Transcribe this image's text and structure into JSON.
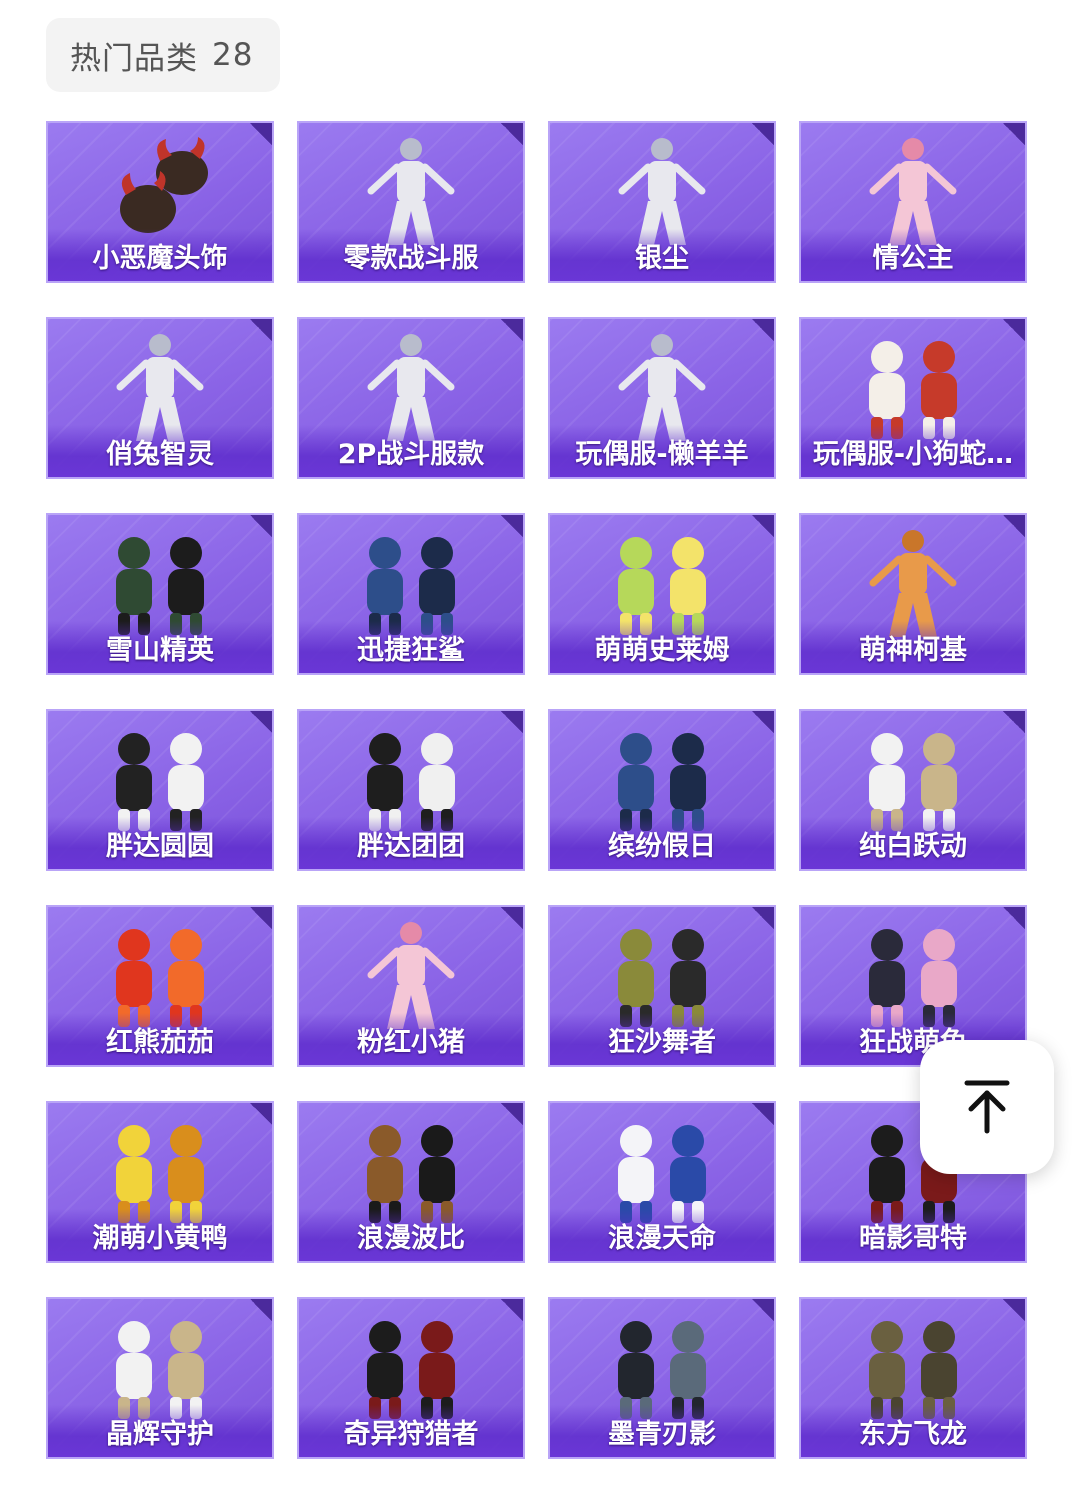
{
  "header": {
    "title": "热门品类",
    "count": "28"
  },
  "back_to_top_icon": "arrow-up-to-top-icon",
  "colors": {
    "card_purple": "#8a63e6",
    "card_border": "#b9a4f7",
    "label_text": "#ffffff"
  },
  "items": [
    {
      "label": "小恶魔头饰",
      "art": "headwear"
    },
    {
      "label": "零款战斗服",
      "art": "figure-white"
    },
    {
      "label": "银尘",
      "art": "figure-white"
    },
    {
      "label": "情公主",
      "art": "figure-pink"
    },
    {
      "label": "俏兔智灵",
      "art": "figure-white"
    },
    {
      "label": "2P战斗服款",
      "art": "figure-white"
    },
    {
      "label": "玩偶服-懒羊羊",
      "art": "figure-white"
    },
    {
      "label": "玩偶服-小狗蛇…",
      "art": "plush-pair"
    },
    {
      "label": "雪山精英",
      "art": "outfit-green"
    },
    {
      "label": "迅捷狂鲨",
      "art": "outfit-blue"
    },
    {
      "label": "萌萌史莱姆",
      "art": "plush-pair-green"
    },
    {
      "label": "萌神柯基",
      "art": "figure-orange"
    },
    {
      "label": "胖达圆圆",
      "art": "plush-pair-panda"
    },
    {
      "label": "胖达团团",
      "art": "outfit-panda"
    },
    {
      "label": "缤纷假日",
      "art": "outfit-blue"
    },
    {
      "label": "纯白跃动",
      "art": "outfit-white"
    },
    {
      "label": "红熊茄茄",
      "art": "plush-pair-red"
    },
    {
      "label": "粉红小猪",
      "art": "figure-pink"
    },
    {
      "label": "狂沙舞者",
      "art": "outfit-olive"
    },
    {
      "label": "狂战萌兔",
      "art": "outfit-pink-black"
    },
    {
      "label": "潮萌小黄鸭",
      "art": "plush-pair-yellow"
    },
    {
      "label": "浪漫波比",
      "art": "outfit-bear"
    },
    {
      "label": "浪漫天命",
      "art": "outfit-white-blue"
    },
    {
      "label": "暗影哥特",
      "art": "outfit-dark-red"
    },
    {
      "label": "晶辉守护",
      "art": "outfit-white"
    },
    {
      "label": "奇异狩猎者",
      "art": "outfit-dark-red"
    },
    {
      "label": "墨青刃影",
      "art": "outfit-dark"
    },
    {
      "label": "东方飞龙",
      "art": "outfit-camo"
    }
  ]
}
